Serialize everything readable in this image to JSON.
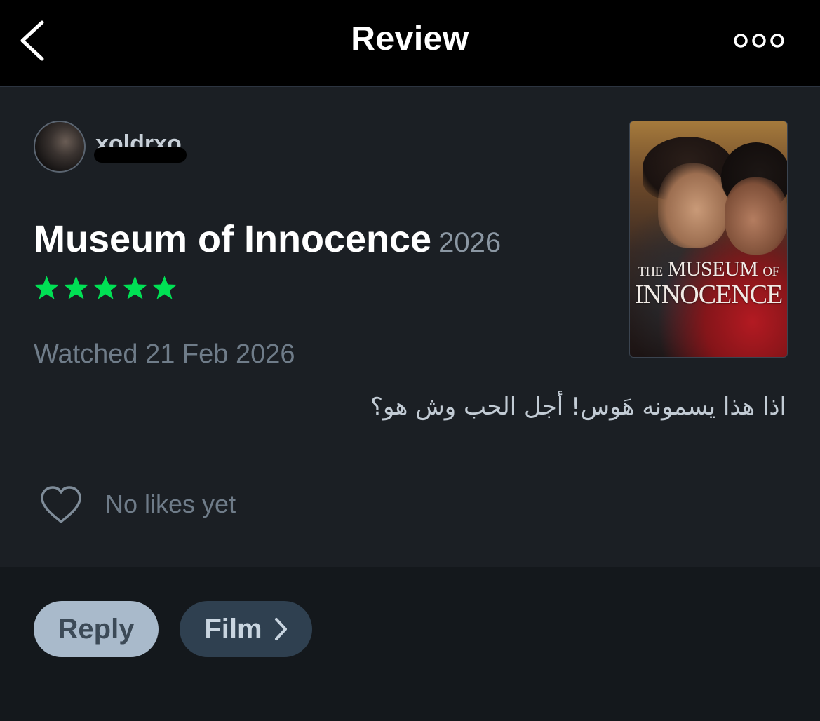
{
  "header": {
    "title": "Review",
    "back_icon": "chevron-left-icon",
    "more_icon": "more-dots-icon"
  },
  "review": {
    "username": "xoldrxo",
    "film_title": "Museum of Innocence",
    "film_year": "2026",
    "rating_stars": 5,
    "rating_max": 5,
    "star_color": "#00e054",
    "watched_date": "Watched 21 Feb 2026",
    "text": "اذا هذا يسمونه هَوس! أجل الحب وش هو؟",
    "poster": {
      "title_line1_small_a": "THE",
      "title_line1_main": "MUSEUM",
      "title_line1_small_b": "OF",
      "title_line2": "INNOCENCE"
    }
  },
  "likes": {
    "icon": "heart-outline-icon",
    "label": "No likes yet"
  },
  "actions": {
    "reply_label": "Reply",
    "film_label": "Film",
    "film_icon": "chevron-right-icon"
  },
  "colors": {
    "header_bg": "#000000",
    "page_bg": "#1b1f24",
    "footer_bg": "#14181c",
    "reply_button_bg": "#a9bacb",
    "film_button_bg": "#2f4050"
  }
}
